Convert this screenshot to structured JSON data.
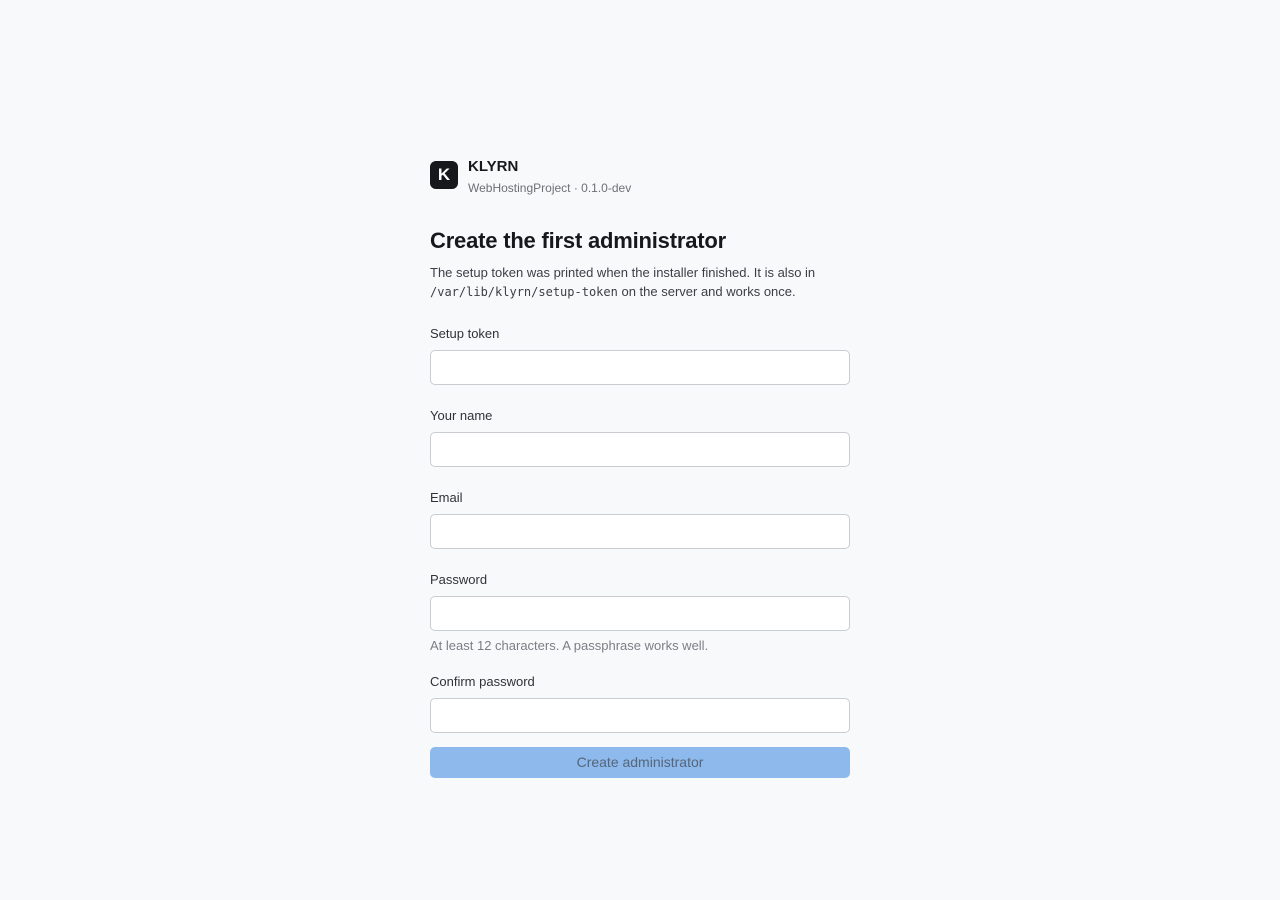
{
  "brand": {
    "logo_letter": "K",
    "name": "KLYRN",
    "subtitle": "WebHostingProject · 0.1.0-dev"
  },
  "heading": "Create the first administrator",
  "description": {
    "part1": "The setup token was printed when the installer finished. It is also in",
    "path": "/var/lib/klyrn/setup-token",
    "part2": "on the server and works once."
  },
  "fields": {
    "setup_token": {
      "label": "Setup token",
      "value": ""
    },
    "name": {
      "label": "Your name",
      "value": ""
    },
    "email": {
      "label": "Email",
      "value": ""
    },
    "password": {
      "label": "Password",
      "value": "",
      "hint": "At least 12 characters. A passphrase works well."
    },
    "confirm_password": {
      "label": "Confirm password",
      "value": ""
    }
  },
  "submit_label": "Create administrator",
  "colors": {
    "background": "#f8f9fa",
    "logo_bg": "#16181b",
    "submit_disabled_bg": "#8db9ec"
  }
}
